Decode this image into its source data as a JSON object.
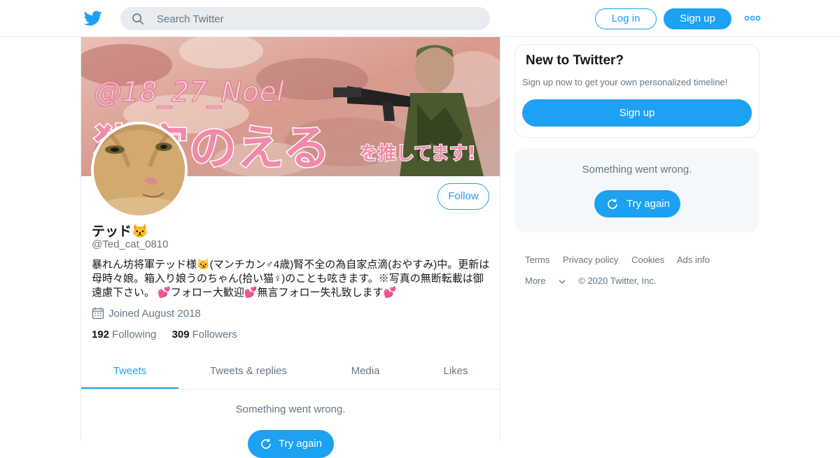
{
  "header": {
    "search_placeholder": "Search Twitter",
    "login_label": "Log in",
    "signup_label": "Sign up"
  },
  "profile": {
    "banner_text_handle": "@18_27_Noel",
    "banner_text_main": "猫宮のえる",
    "banner_text_tail": "を推してます!",
    "display_name": "テッド😾",
    "handle": "@Ted_cat_0810",
    "follow_label": "Follow",
    "bio": "暴れん坊将軍テッド様😼(マンチカン♂4歳)腎不全の為自家点滴(おやすみ)中。更新は母時々娘。箱入り娘うのちゃん(拾い猫♀)のことも呟きます。※写真の無断転載は御遠慮下さい。 💕フォロー大歓迎💕無言フォロー失礼致します💕",
    "joined": "Joined August 2018",
    "following_count": "192",
    "following_label": "Following",
    "followers_count": "309",
    "followers_label": "Followers"
  },
  "tabs": [
    "Tweets",
    "Tweets & replies",
    "Media",
    "Likes"
  ],
  "timeline": {
    "error_text": "Something went wrong.",
    "retry_label": "Try again"
  },
  "sidebar": {
    "signup_title": "New to Twitter?",
    "signup_subtitle": "Sign up now to get your own personalized timeline!",
    "signup_button": "Sign up",
    "error_text": "Something went wrong.",
    "retry_label": "Try again"
  },
  "footer": {
    "links": [
      "Terms",
      "Privacy policy",
      "Cookies",
      "Ads info"
    ],
    "more_label": "More",
    "copyright": "© 2020 Twitter, Inc."
  },
  "colors": {
    "accent": "#1da1f2",
    "secondary_text": "#657786",
    "border": "#e6ecf0"
  }
}
